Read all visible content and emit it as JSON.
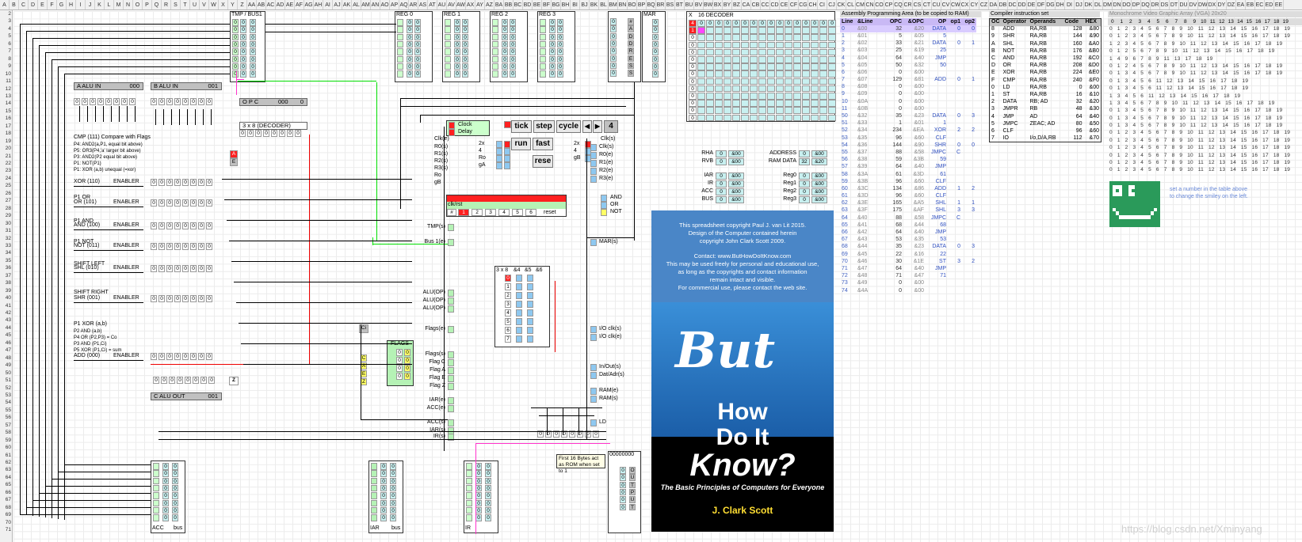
{
  "spreadsheet": {
    "columns": [
      "A",
      "B",
      "C",
      "D",
      "E",
      "F",
      "G",
      "H",
      "I",
      "J",
      "K",
      "L",
      "M",
      "N",
      "O",
      "P",
      "Q",
      "R",
      "S",
      "T",
      "U",
      "V",
      "W",
      "X",
      "Y",
      "Z",
      "AA",
      "AB",
      "AC",
      "AD",
      "AE",
      "AF",
      "AG",
      "AH",
      "AI",
      "AJ",
      "AK",
      "AL",
      "AM",
      "AN",
      "AO",
      "AP",
      "AQ",
      "AR",
      "AS",
      "AT",
      "AU",
      "AV",
      "AW",
      "AX",
      "AY",
      "AZ",
      "BA",
      "BB",
      "BC",
      "BD",
      "BE",
      "BF",
      "BG",
      "BH",
      "BI",
      "BJ",
      "BK",
      "BL",
      "BM",
      "BN",
      "BO",
      "BP",
      "BQ",
      "BR",
      "BS",
      "BT",
      "BU",
      "BV",
      "BW",
      "BX",
      "BY",
      "BZ",
      "CA",
      "CB",
      "CC",
      "CD",
      "CE",
      "CF",
      "CG",
      "CH",
      "CI",
      "CJ",
      "CK",
      "CL",
      "CM",
      "CN",
      "CO",
      "CP",
      "CQ",
      "CR",
      "CS",
      "CT",
      "CU",
      "CV",
      "CW",
      "CX",
      "CY",
      "CZ",
      "DA",
      "DB",
      "DC",
      "DD",
      "DE",
      "DF",
      "DG",
      "DH",
      "DI",
      "DJ",
      "DK",
      "DL",
      "DM",
      "DN",
      "DO",
      "DP",
      "DQ",
      "DR",
      "DS",
      "DT",
      "DU",
      "DV",
      "DW",
      "DX",
      "DY",
      "DZ",
      "EA",
      "EB",
      "EC",
      "ED",
      "EE"
    ],
    "rows": [
      "2",
      "3",
      "4",
      "5",
      "6",
      "7",
      "8",
      "9",
      "10",
      "11",
      "12",
      "13",
      "14",
      "15",
      "16",
      "17",
      "18",
      "19",
      "20",
      "21",
      "22",
      "23",
      "24",
      "25",
      "26",
      "27",
      "28",
      "29",
      "30",
      "31",
      "32",
      "33",
      "34",
      "35",
      "36",
      "37",
      "38",
      "39",
      "40",
      "41",
      "42",
      "43",
      "44",
      "45",
      "46",
      "47",
      "48",
      "49",
      "50",
      "51",
      "52",
      "53",
      "54",
      "55",
      "56",
      "57",
      "58",
      "59",
      "60",
      "61",
      "62",
      "63",
      "64",
      "65",
      "66",
      "67",
      "68",
      "69",
      "70",
      "71"
    ]
  },
  "cpu": {
    "tmp_bus_label": "TMP / BUS1",
    "reg_labels": [
      "REG 0",
      "REG 1",
      "REG 2",
      "REG 3"
    ],
    "mar_label": "MAR",
    "hash_label": "#",
    "alu_a_label": "A   ALU IN",
    "alu_a_value": "000",
    "alu_b_label": "B   ALU IN",
    "alu_b_value": "001",
    "opc_label": "O  P  C",
    "opc_value": "000",
    "opc_zero": "0",
    "decoder_label": "3 x 8 (DECODER)",
    "alu_out_label": "C   ALU OUT",
    "alu_out_value": "001",
    "ops": [
      {
        "title": "CMP (111) Compare with Flags",
        "enabler": "",
        "rows": [
          "P4: AND2(a,P1, equal bit above)",
          "P5: OR3(P4,'a' larger bit above)",
          "P3: AND2(P2 equal bit above)",
          "P1: NOT(P1)",
          "P1: XOR (a,b)   unequal (=xor)"
        ]
      },
      {
        "title": "XOR (110)",
        "enabler": "ENABLER",
        "rows": []
      },
      {
        "title": "P1 OR",
        "enabler": "",
        "rows": []
      },
      {
        "title": "OR (101)",
        "enabler": "ENABLER",
        "rows": []
      },
      {
        "title": "P1 AND",
        "enabler": "",
        "rows": []
      },
      {
        "title": "AND (100)",
        "enabler": "ENABLER",
        "rows": []
      },
      {
        "title": "P1 NOT",
        "enabler": "",
        "rows": []
      },
      {
        "title": "NOT (011)",
        "enabler": "ENABLER",
        "rows": []
      },
      {
        "title": "SHIFT LEFT",
        "enabler": "",
        "rows": []
      },
      {
        "title": "SHL (010)",
        "enabler": "ENABLER",
        "rows": []
      },
      {
        "title": "SHIFT RIGHT",
        "enabler": "",
        "rows": []
      },
      {
        "title": "SHR (001)",
        "enabler": "ENABLER",
        "rows": []
      },
      {
        "title": "P1 XOR (a,b)",
        "enabler": "",
        "rows": [
          "P2 AND (a,b)",
          "P4 OR (P2,P3) = Co",
          "P3 AND (P1,Ci)",
          "P5 XOR (P1,Ci) = sum"
        ]
      },
      {
        "title": "ADD (000)",
        "enabler": "ENABLER",
        "rows": []
      }
    ],
    "cmp_flags": [
      "A",
      "E"
    ],
    "cmp_flag_values": [
      "0",
      "1"
    ],
    "flags_label": "FLAGS",
    "flags": [
      {
        "name": "C",
        "value": "0"
      },
      {
        "name": "A",
        "value": "0"
      },
      {
        "name": "E",
        "value": "0"
      },
      {
        "name": "Z",
        "value": "0"
      }
    ],
    "ci_label": "Ci",
    "z_label": "Z",
    "bottom_regs": [
      {
        "name": "ACC",
        "right": "bus"
      },
      {
        "name": "IAR",
        "right": "bus"
      },
      {
        "name": "IR",
        "right": ""
      }
    ],
    "right_col_letters": [
      "#",
      "A",
      "D",
      "D",
      "R",
      "E",
      "S",
      "S"
    ],
    "right_col_letters2": [
      "O",
      "U",
      "T",
      "P",
      "U",
      "T",
      "",
      ""
    ],
    "memory_address_value": "00000000",
    "rom_note": "First 16 Bytes act as ROM when set to 1",
    "signals_left": [
      "TMP(s)",
      "Bus 1(e)",
      "ALU(OP)",
      "ALU(OP)",
      "ALU(OP)",
      "Flags(e)",
      "Flags(s)",
      "Flag  C",
      "Flag  A",
      "Flag  E",
      "Flag  Z",
      "IAR(e)",
      "ACC(e)",
      "ACC(s)",
      "IAR(s)",
      "IR(s)"
    ],
    "signals_right": [
      "Clk(s)",
      "R0(e)",
      "R1(e)",
      "R2(e)",
      "R3(e)",
      "MAR(s)",
      "I/O clk(s)",
      "I/O clk(e)",
      "In/Out(s)",
      "Dat/Adr(s)",
      "RAM(e)",
      "RAM(s)",
      "LD"
    ],
    "signals_right_mid": [
      "R0(s)",
      "R1(s)",
      "R2(s)",
      "R3(s)",
      "Ro",
      "gB"
    ],
    "clock_label": "Clock",
    "delay_label": "Delay",
    "clk_e": "Clk(e)",
    "clk_s": "Clk(s)",
    "stepper_label": "clk/rst",
    "stepper_reset": "reset",
    "stepper_steps": [
      "1",
      "2",
      "3",
      "4",
      "5",
      "6"
    ],
    "step_hdr": "#",
    "gate_labels": [
      "AND",
      "OR",
      "NOT"
    ],
    "decoder_small": "3 x 8",
    "decoder_small_cols": [
      "&4",
      "&5",
      "&6"
    ],
    "decoder_small_rows": [
      "0",
      "1",
      "2",
      "3",
      "4",
      "5",
      "6",
      "7"
    ],
    "gate_mid": [
      "2x",
      "4",
      "Ro",
      "gA"
    ],
    "gate_mid2": [
      "2x",
      "4",
      "gB"
    ]
  },
  "controls": {
    "buttons": [
      "tick",
      "step",
      "cycle"
    ],
    "arrow_left": "◀",
    "arrow_right": "▶",
    "step_count": "4",
    "run": "run",
    "fast": "fast",
    "reset": "rese"
  },
  "decoder16": {
    "label": "16 DECODER",
    "x_label": "X",
    "col_values": [
      "4",
      "1"
    ],
    "red_value": "4",
    "zero": "0"
  },
  "mem": {
    "rows": [
      {
        "label": "RHA",
        "value": "0",
        "hex": "&00"
      },
      {
        "label": "RVB",
        "value": "0",
        "hex": "&00"
      },
      {
        "label": "IAR",
        "value": "0",
        "hex": "&00"
      },
      {
        "label": "IR",
        "value": "0",
        "hex": "&00"
      },
      {
        "label": "ACC",
        "value": "0",
        "hex": "&00"
      },
      {
        "label": "BUS",
        "value": "0",
        "hex": "&00"
      }
    ],
    "address_label": "ADDRESS",
    "address_value": "0",
    "address_hex": "&00",
    "ramdata_label": "RAM DATA",
    "ramdata_value": "32",
    "ramdata_hex": "&20",
    "regs": [
      {
        "label": "Reg0",
        "value": "0",
        "hex": "&00"
      },
      {
        "label": "Reg1",
        "value": "0",
        "hex": "&00"
      },
      {
        "label": "Reg2",
        "value": "0",
        "hex": "&00"
      },
      {
        "label": "Reg3",
        "value": "0",
        "hex": "&00"
      }
    ]
  },
  "asm": {
    "title": "Assembly Programming Area (to be copied to RAM)",
    "headers": [
      "Line",
      "&Line",
      "OPC",
      "&OPC",
      "OP",
      "op1",
      "op2"
    ],
    "rows": [
      [
        "0",
        "&00",
        "32",
        "&20",
        "DATA",
        "0",
        "0"
      ],
      [
        "1",
        "&01",
        "5",
        "&05",
        "5",
        "",
        ""
      ],
      [
        "2",
        "&02",
        "33",
        "&21",
        "DATA",
        "0",
        "1"
      ],
      [
        "3",
        "&03",
        "25",
        "&19",
        "25",
        "",
        ""
      ],
      [
        "4",
        "&04",
        "64",
        "&40",
        "JMP",
        "",
        ""
      ],
      [
        "5",
        "&05",
        "50",
        "&32",
        "50",
        "",
        ""
      ],
      [
        "6",
        "&06",
        "0",
        "&00",
        "",
        "",
        ""
      ],
      [
        "7",
        "&07",
        "129",
        "&81",
        "ADD",
        "0",
        "1"
      ],
      [
        "8",
        "&08",
        "0",
        "&00",
        "",
        "",
        ""
      ],
      [
        "9",
        "&09",
        "0",
        "&00",
        "",
        "",
        ""
      ],
      [
        "10",
        "&0A",
        "0",
        "&00",
        "",
        "",
        ""
      ],
      [
        "11",
        "&0B",
        "0",
        "&00",
        "",
        "",
        ""
      ],
      [
        "50",
        "&32",
        "35",
        "&23",
        "DATA",
        "0",
        "3"
      ],
      [
        "51",
        "&33",
        "1",
        "&01",
        "1",
        "",
        ""
      ],
      [
        "52",
        "&34",
        "234",
        "&EA",
        "XOR",
        "2",
        "2"
      ],
      [
        "53",
        "&35",
        "96",
        "&60",
        "CLF",
        "",
        ""
      ],
      [
        "54",
        "&36",
        "144",
        "&90",
        "SHR",
        "0",
        "0"
      ],
      [
        "55",
        "&37",
        "88",
        "&58",
        "JMPC",
        "C",
        ""
      ],
      [
        "56",
        "&38",
        "59",
        "&3B",
        "59",
        "",
        ""
      ],
      [
        "57",
        "&39",
        "64",
        "&40",
        "JMP",
        "",
        ""
      ],
      [
        "58",
        "&3A",
        "61",
        "&3D",
        "61",
        "",
        ""
      ],
      [
        "59",
        "&3B",
        "96",
        "&60",
        "CLF",
        "",
        ""
      ],
      [
        "60",
        "&3C",
        "134",
        "&86",
        "ADD",
        "1",
        "2"
      ],
      [
        "61",
        "&3D",
        "96",
        "&60",
        "CLF",
        "",
        ""
      ],
      [
        "62",
        "&3E",
        "165",
        "&A5",
        "SHL",
        "1",
        "1"
      ],
      [
        "63",
        "&3F",
        "175",
        "&AF",
        "SHL",
        "3",
        "3"
      ],
      [
        "64",
        "&40",
        "88",
        "&58",
        "JMPC",
        "C",
        ""
      ],
      [
        "65",
        "&41",
        "68",
        "&44",
        "68",
        "",
        ""
      ],
      [
        "66",
        "&42",
        "64",
        "&40",
        "JMP",
        "",
        ""
      ],
      [
        "67",
        "&43",
        "53",
        "&35",
        "53",
        "",
        ""
      ],
      [
        "68",
        "&44",
        "35",
        "&23",
        "DATA",
        "0",
        "3"
      ],
      [
        "69",
        "&45",
        "22",
        "&16",
        "22",
        "",
        ""
      ],
      [
        "70",
        "&46",
        "30",
        "&1E",
        "ST",
        "3",
        "2"
      ],
      [
        "71",
        "&47",
        "64",
        "&40",
        "JMP",
        "",
        ""
      ],
      [
        "72",
        "&48",
        "71",
        "&47",
        "71",
        "",
        ""
      ],
      [
        "73",
        "&49",
        "0",
        "&00",
        "",
        "",
        ""
      ],
      [
        "74",
        "&4A",
        "0",
        "&00",
        "",
        "",
        ""
      ]
    ]
  },
  "compiler": {
    "title": "Compiler instruction set",
    "headers": [
      "OC",
      "Operator",
      "Operands",
      "Code",
      "HEX"
    ],
    "rows": [
      [
        "8",
        "ADD",
        "RA,RB",
        "128",
        "&80"
      ],
      [
        "9",
        "SHR",
        "RA,RB",
        "144",
        "&90"
      ],
      [
        "A",
        "SHL",
        "RA,RB",
        "160",
        "&A0"
      ],
      [
        "B",
        "NOT",
        "RA,RB",
        "176",
        "&B0"
      ],
      [
        "C",
        "AND",
        "RA,RB",
        "192",
        "&C0"
      ],
      [
        "D",
        "OR",
        "RA,RB",
        "208",
        "&D0"
      ],
      [
        "E",
        "XOR",
        "RA,RB",
        "224",
        "&E0"
      ],
      [
        "F",
        "CMP",
        "RA,RB",
        "240",
        "&F0"
      ],
      [
        "0",
        "LD",
        "RA,RB",
        "0",
        "&00"
      ],
      [
        "1",
        "ST",
        "RA,RB",
        "16",
        "&10"
      ],
      [
        "2",
        "DATA",
        "RB; AD",
        "32",
        "&20"
      ],
      [
        "3",
        "JMPR",
        "RB",
        "48",
        "&30"
      ],
      [
        "4",
        "JMP",
        "AD",
        "64",
        "&40"
      ],
      [
        "5",
        "JMPC",
        "ZEAC; AD",
        "80",
        "&50"
      ],
      [
        "6",
        "CLF",
        "",
        "96",
        "&60"
      ],
      [
        "7",
        "IO",
        "I/o,D/A,RB",
        "112",
        "&70"
      ]
    ]
  },
  "vga": {
    "title": "Monochrome Video Graphic Array (VGA) 20x20",
    "header_nums": [
      "0",
      "1",
      "2",
      "3",
      "4",
      "5",
      "6",
      "7",
      "8",
      "9",
      "10",
      "11",
      "12",
      "13",
      "14",
      "15",
      "16",
      "17",
      "18",
      "19"
    ],
    "rows": [
      "0 1 2 3 4 5 6 7 8 9 10 11 12 13 14 15 16 17 18 19",
      "0 1 2 3 4 5 6 7 8 9 10 11 12 13 14 15 16 17 18 19",
      "1 2 3 4 5 6 7 8 9 10 11 12 13 14 15 16 17 18 19",
      "0 1 2 5 6 7 8 9 10 11 12 13 14 15 16 17 18 19",
      "1 4 9 6 7 8 9 11 13 17 18 19",
      "0 1 2 4 5 6 7 8 9 10 11 12 13 14 15 16 17 18 19",
      "0 1 3 4 5 6 7 8 9 10 11 12 13 14 15 16 17 18 19",
      "0 1 3 4 5 6 11 12 13 14 15 16 17 18 19",
      "0 1 3 4 5 6 11 12 13 14 15 16 17 18 19",
      "1 3 4 5 6 11 12 13 14 15 16 17 18 19",
      "1 3 4 5 6 7 8 9 10 11 12 13 14 15 16 17 18 19",
      "0 1 3 4 5 6 7 8 9 10 11 12 13 14 15 16 17 18 19",
      "0 1 3 4 5 6 7 8 9 10 11 12 13 14 15 16 17 18 19",
      "0 1 3 4 5 6 7 8 9 10 11 12 13 14 15 16 17 18 19",
      "0 1 2 3 4 5 6 7 8 9 10 11 12 13 14 15 16 17 18 19",
      "0 1 2 3 4 5 6 7 8 9 10 11 12 13 14 15 16 17 18 19",
      "0 1 2 3 4 5 6 7 8 9 10 11 12 13 14 15 16 17 18 19",
      "0 1 2 3 4 5 6 7 8 9 10 11 12 13 14 15 16 17 18 19",
      "0 1 2 3 4 5 6 7 8 9 10 11 12 13 14 15 16 17 18 19",
      "0 1 2 3 4 5 6 7 8 9 10 11 12 13 14 15 16 17 18 19"
    ],
    "smiley_note_1": "set a number in the table above",
    "smiley_note_2": "to change the smiley on the left."
  },
  "book": {
    "copyright": [
      "This spreadsheet copyright Paul J. van Lit 2015.",
      "Design of the Computer contained herein",
      "copyright John Clark Scott 2009.",
      "",
      "Contact: www.ButHowDoItKnow.com",
      "This may be used freely for personal and educational use,",
      "as long as the copyrights and contact information",
      "remain intact and visible.",
      "For commercial use, please contact the web site."
    ],
    "but": "But",
    "how": "How",
    "do_it": "Do It",
    "know": "Know?",
    "subtitle": "The Basic Principles of Computers for Everyone",
    "author": "J. Clark Scott"
  },
  "watermark": "https://blog.csdn.net/Xminyang",
  "colors": {
    "cyan": "#c8f0f0",
    "green": "#b5f2b5",
    "pink": "#ff44ff",
    "red": "#ff2020",
    "yellow": "#ffff66",
    "wire_green": "#00dd00",
    "wire_red": "#ee0000",
    "wire_pink": "#ff33cc",
    "book_blue": "#4a86c7"
  }
}
